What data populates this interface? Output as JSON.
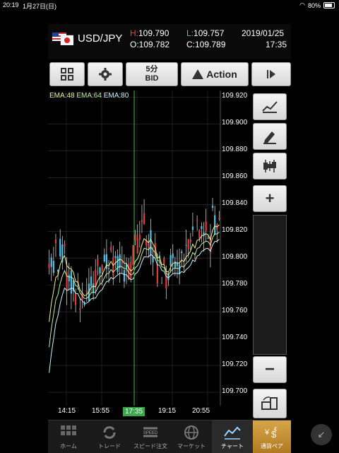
{
  "status": {
    "time": "20:19",
    "date": "1月27日(日)",
    "battery": "80%"
  },
  "header": {
    "pair": "USD/JPY",
    "high_label": "H:",
    "high": "109.790",
    "low_label": "L:",
    "low": "109.757",
    "open_label": "O:",
    "open": "109.782",
    "close_label": "C:",
    "close": "109.789",
    "date": "2019/01/25",
    "time": "17:35"
  },
  "toolbar": {
    "interval": "5分",
    "price_type": "BID",
    "action": "Action"
  },
  "chart": {
    "ema_labels": [
      "EMA:48",
      "EMA:64",
      "EMA:80"
    ],
    "colors": {
      "ema48": "#f1f58a",
      "ema64": "#b9f2a6",
      "ema80": "#c9f5ff",
      "up": "#4fc4e8",
      "down": "#e43b3b",
      "cursor": "#38c54a"
    },
    "y_labels": [
      "109.920",
      "109.900",
      "109.880",
      "109.860",
      "109.840",
      "109.820",
      "109.800",
      "109.780",
      "109.760",
      "109.740",
      "109.720",
      "109.700"
    ],
    "x_labels": [
      "14:15",
      "15:55",
      "17:35",
      "19:15",
      "20:55"
    ],
    "selected_x": "17:35"
  },
  "chart_data": {
    "type": "candlestick",
    "xlabel": "",
    "ylabel": "",
    "ylim": [
      109.69,
      109.925
    ],
    "x": [
      "14:15",
      "15:55",
      "17:35",
      "19:15",
      "20:55"
    ],
    "series": [
      {
        "name": "EMA:48"
      },
      {
        "name": "EMA:64"
      },
      {
        "name": "EMA:80"
      }
    ]
  },
  "tabs": [
    {
      "label": "ホーム",
      "icon": "grid-icon"
    },
    {
      "label": "トレード",
      "icon": "refresh-icon"
    },
    {
      "label": "スピード注文",
      "icon": "speed-icon"
    },
    {
      "label": "マーケット",
      "icon": "globe-icon"
    },
    {
      "label": "チャート",
      "icon": "chart-icon",
      "active": true
    },
    {
      "label": "通貨ペア",
      "icon": "currency-icon"
    }
  ]
}
